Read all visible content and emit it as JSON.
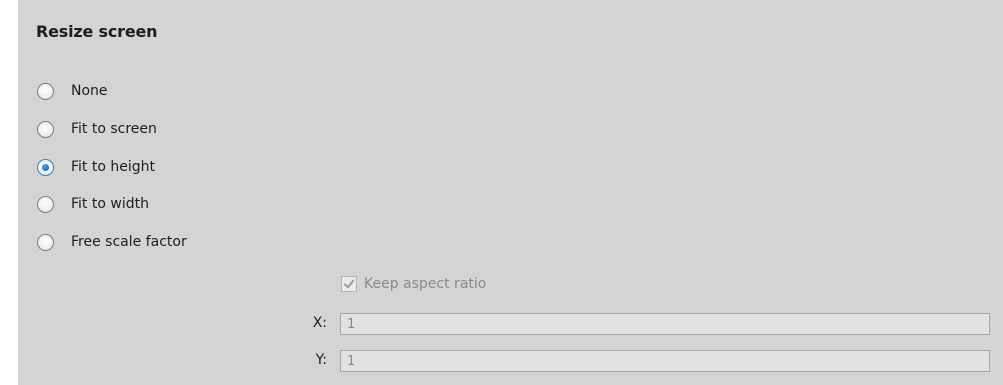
{
  "section": {
    "title": "Resize screen"
  },
  "options": [
    {
      "label": "None",
      "checked": false
    },
    {
      "label": "Fit to screen",
      "checked": false
    },
    {
      "label": "Fit to height",
      "checked": true
    },
    {
      "label": "Fit to width",
      "checked": false
    },
    {
      "label": "Free scale factor",
      "checked": false
    }
  ],
  "keep_aspect": {
    "label": "Keep aspect ratio",
    "checked": true,
    "enabled": false
  },
  "scale_x": {
    "label": "X:",
    "value": "1",
    "enabled": false
  },
  "scale_y": {
    "label": "Y:",
    "value": "1",
    "enabled": false
  },
  "colors": {
    "panel_bg": "#d4d4d4",
    "radio_selected": "#1a6ec0",
    "disabled_text": "#8a8a8a"
  }
}
